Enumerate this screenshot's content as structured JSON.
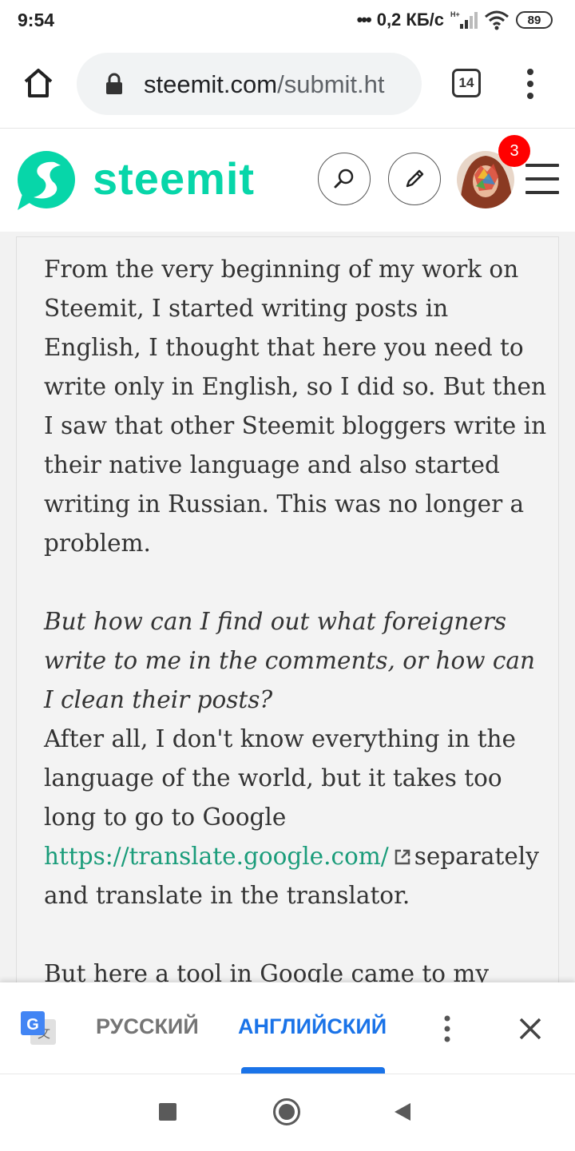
{
  "status_bar": {
    "time": "9:54",
    "network_speed": "0,2 КБ/с",
    "signal_label": "H+",
    "battery": "89"
  },
  "browser": {
    "url_domain": "steemit.com",
    "url_path": "/submit.ht",
    "tab_count": "14"
  },
  "site": {
    "logo_text": "steemit",
    "brand_color": "#07d6a9",
    "notification_count": "3"
  },
  "article": {
    "paragraph1": "From the very beginning of my work on Steemit, I started writing posts in English, I thought that here you need to write only in English, so I did so. But then I saw that other Steemit bloggers write in their native language and also started writing in Russian. This was no longer a problem.",
    "question": "But how can I find out what foreigners write to me in the comments, or how can I clean their posts?",
    "paragraph2_start": "After all, I don't know everything in the language of the world, but it takes too long to go to Google ",
    "link_text": "https://translate.google.com/",
    "paragraph2_end": "separately and translate in the translator.",
    "paragraph3_start": "But here a tool in Google came to my"
  },
  "translate_bar": {
    "source_language": "РУССКИЙ",
    "target_language": "АНГЛИЙСКИЙ",
    "active_color": "#1a73e8"
  }
}
